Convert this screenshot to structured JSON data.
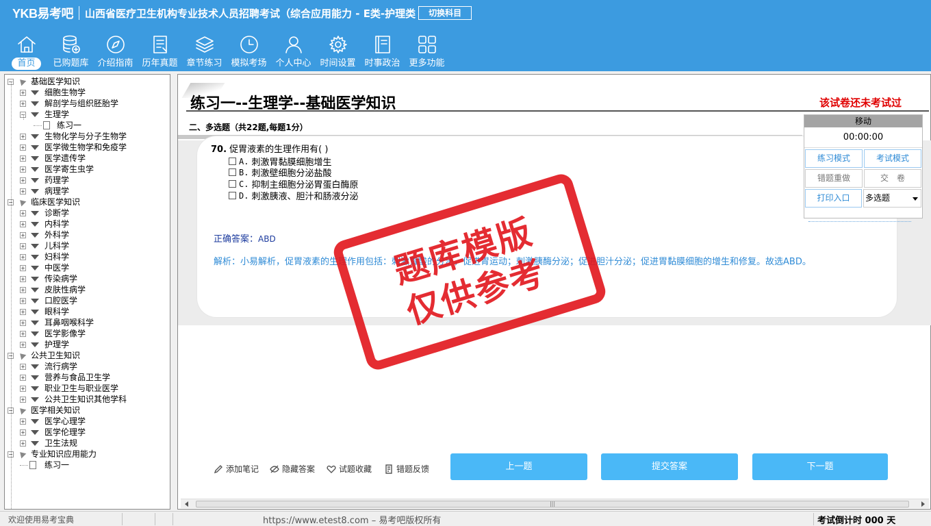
{
  "header": {
    "logo": "YKB易考吧",
    "title": "山西省医疗卫生机构专业技术人员招聘考试（综合应用能力 - E类-护理类",
    "switch_label": "切换科目"
  },
  "nav": [
    {
      "label": "首页",
      "icon": "home-icon"
    },
    {
      "label": "已购题库",
      "icon": "database-icon"
    },
    {
      "label": "介绍指南",
      "icon": "compass-icon"
    },
    {
      "label": "历年真题",
      "icon": "document-list-icon"
    },
    {
      "label": "章节练习",
      "icon": "layers-icon"
    },
    {
      "label": "模拟考场",
      "icon": "clock-icon"
    },
    {
      "label": "个人中心",
      "icon": "user-icon"
    },
    {
      "label": "时间设置",
      "icon": "gear-icon"
    },
    {
      "label": "时事政治",
      "icon": "notebook-icon"
    },
    {
      "label": "更多功能",
      "icon": "grid-icon"
    }
  ],
  "tree": [
    {
      "label": "基础医学知识",
      "level": 0,
      "toggle": "-"
    },
    {
      "label": "细胞生物学",
      "level": 1,
      "toggle": "+"
    },
    {
      "label": "解剖学与组织胚胎学",
      "level": 1,
      "toggle": "+"
    },
    {
      "label": "生理学",
      "level": 1,
      "toggle": "-"
    },
    {
      "label": "练习一",
      "level": 2,
      "toggle": ""
    },
    {
      "label": "生物化学与分子生物学",
      "level": 1,
      "toggle": "+"
    },
    {
      "label": "医学微生物学和免疫学",
      "level": 1,
      "toggle": "+"
    },
    {
      "label": "医学遗传学",
      "level": 1,
      "toggle": "+"
    },
    {
      "label": "医学寄生虫学",
      "level": 1,
      "toggle": "+"
    },
    {
      "label": "药理学",
      "level": 1,
      "toggle": "+"
    },
    {
      "label": "病理学",
      "level": 1,
      "toggle": "+"
    },
    {
      "label": "临床医学知识",
      "level": 0,
      "toggle": "-"
    },
    {
      "label": "诊断学",
      "level": 1,
      "toggle": "+"
    },
    {
      "label": "内科学",
      "level": 1,
      "toggle": "+"
    },
    {
      "label": "外科学",
      "level": 1,
      "toggle": "+"
    },
    {
      "label": "儿科学",
      "level": 1,
      "toggle": "+"
    },
    {
      "label": "妇科学",
      "level": 1,
      "toggle": "+"
    },
    {
      "label": "中医学",
      "level": 1,
      "toggle": "+"
    },
    {
      "label": "传染病学",
      "level": 1,
      "toggle": "+"
    },
    {
      "label": "皮肤性病学",
      "level": 1,
      "toggle": "+"
    },
    {
      "label": "口腔医学",
      "level": 1,
      "toggle": "+"
    },
    {
      "label": "眼科学",
      "level": 1,
      "toggle": "+"
    },
    {
      "label": "耳鼻咽喉科学",
      "level": 1,
      "toggle": "+"
    },
    {
      "label": "医学影像学",
      "level": 1,
      "toggle": "+"
    },
    {
      "label": "护理学",
      "level": 1,
      "toggle": "+"
    },
    {
      "label": "公共卫生知识",
      "level": 0,
      "toggle": "-"
    },
    {
      "label": "流行病学",
      "level": 1,
      "toggle": "+"
    },
    {
      "label": "营养与食品卫生学",
      "level": 1,
      "toggle": "+"
    },
    {
      "label": "职业卫生与职业医学",
      "level": 1,
      "toggle": "+"
    },
    {
      "label": "公共卫生知识其他学科",
      "level": 1,
      "toggle": "+"
    },
    {
      "label": "医学相关知识",
      "level": 0,
      "toggle": "-"
    },
    {
      "label": "医学心理学",
      "level": 1,
      "toggle": "+"
    },
    {
      "label": "医学伦理学",
      "level": 1,
      "toggle": "+"
    },
    {
      "label": "卫生法规",
      "level": 1,
      "toggle": "+"
    },
    {
      "label": "专业知识应用能力",
      "level": 0,
      "toggle": "-"
    },
    {
      "label": "练习一",
      "level": 1,
      "toggle": "",
      "leaf": true
    }
  ],
  "paper": {
    "title": "练习一--生理学--基础医学知识",
    "status": "该试卷还未考试过",
    "section": "二、多选题（共22题,每题1分）"
  },
  "question": {
    "number": "70.",
    "stem": "促胃液素的生理作用有( )",
    "options": [
      {
        "letter": "A.",
        "text": "刺激胃黏膜细胞增生"
      },
      {
        "letter": "B.",
        "text": "刺激壁细胞分泌盐酸"
      },
      {
        "letter": "C.",
        "text": "抑制主细胞分泌胃蛋白酶原"
      },
      {
        "letter": "D.",
        "text": "刺激胰液、胆汁和肠液分泌"
      }
    ],
    "answer_label": "正确答案：",
    "answer_value": "ABD",
    "analysis": "解析：小易解析，促胃液素的生理作用包括：刺激胃酸的分泌，促进胃运动；刺激胰酶分泌；促进胆汁分泌；促进胃黏膜细胞的增生和修复。故选ABD。"
  },
  "stamp": {
    "line1": "题库模版",
    "line2": "仅供参考"
  },
  "panel": {
    "header": "移动",
    "timer": "00:00:00",
    "practice_mode": "练习模式",
    "exam_mode": "考试模式",
    "redo_wrong": "错题重做",
    "submit_paper": "交　卷",
    "print": "打印入口",
    "qtype": "多选题"
  },
  "tools": {
    "note": "添加笔记",
    "hide_answer": "隐藏答案",
    "favorite": "试题收藏",
    "feedback": "错题反馈"
  },
  "buttons": {
    "prev": "上一题",
    "submit": "提交答案",
    "next": "下一题"
  },
  "statusbar": {
    "left": "欢迎使用易考宝典",
    "center": "https://www.etest8.com – 易考吧版权所有",
    "right": "考试倒计时 000 天"
  }
}
